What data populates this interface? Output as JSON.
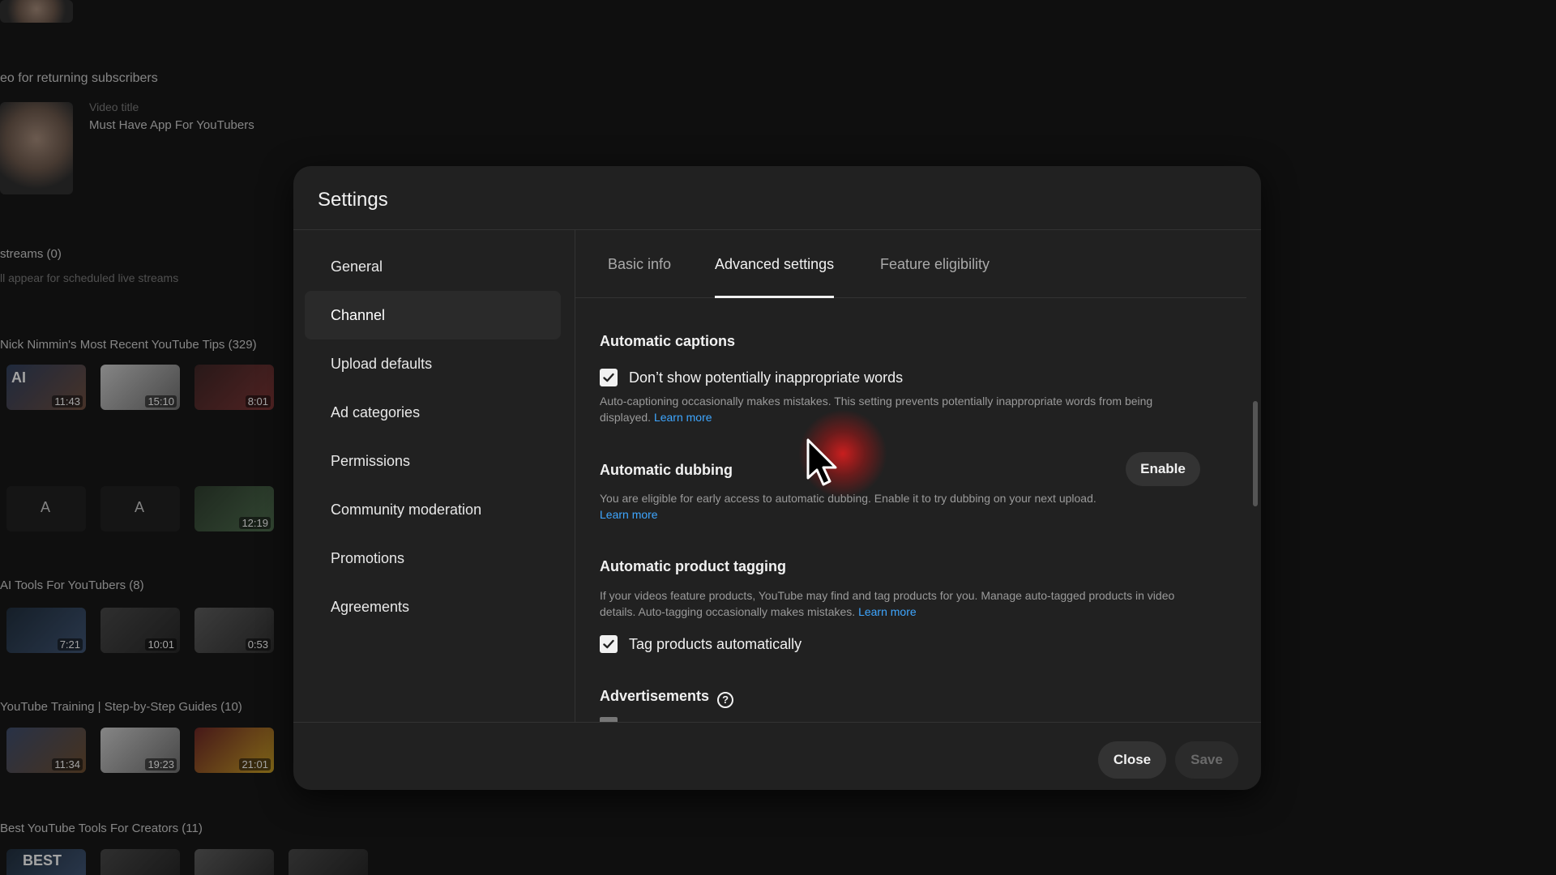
{
  "background": {
    "top_text": "eo for returning subscribers",
    "video_title_label": "Video title",
    "video_title": "Must Have App For YouTubers",
    "streams_heading": "streams (0)",
    "streams_sub": "ll appear for scheduled live streams",
    "playlists": [
      {
        "title": "Nick Nimmin's Most Recent YouTube Tips (329)",
        "durations": [
          "11:43",
          "15:10",
          "8:01"
        ],
        "first_label": "AI"
      },
      {
        "title": "",
        "durations": [
          "",
          "",
          "12:19"
        ],
        "first_label": "A",
        "second_label": "A"
      },
      {
        "title": "AI Tools For YouTubers (8)",
        "durations": [
          "7:21",
          "10:01",
          "0:53"
        ]
      },
      {
        "title": "YouTube Training | Step-by-Step Guides (10)",
        "durations": [
          "11:34",
          "19:23",
          "21:01"
        ]
      },
      {
        "title": "Best YouTube Tools For Creators (11)",
        "durations": [],
        "first_label": "BEST"
      }
    ]
  },
  "modal": {
    "title": "Settings",
    "sidebar": [
      {
        "label": "General"
      },
      {
        "label": "Channel",
        "active": true
      },
      {
        "label": "Upload defaults"
      },
      {
        "label": "Ad categories"
      },
      {
        "label": "Permissions"
      },
      {
        "label": "Community moderation"
      },
      {
        "label": "Promotions"
      },
      {
        "label": "Agreements"
      }
    ],
    "tabs": [
      {
        "label": "Basic info"
      },
      {
        "label": "Advanced settings",
        "active": true
      },
      {
        "label": "Feature eligibility"
      }
    ],
    "sections": {
      "captions": {
        "title": "Automatic captions",
        "checkbox_label": "Don’t show potentially inappropriate words",
        "checked": true,
        "description": "Auto-captioning occasionally makes mistakes. This setting prevents potentially inappropriate words from being displayed.",
        "link": "Learn more"
      },
      "dubbing": {
        "title": "Automatic dubbing",
        "description": "You are eligible for early access to automatic dubbing. Enable it to try dubbing on your next upload.",
        "link": "Learn more",
        "button": "Enable"
      },
      "tagging": {
        "title": "Automatic product tagging",
        "description": "If your videos feature products, YouTube may find and tag products for you. Manage auto-tagged products in video details. Auto-tagging occasionally makes mistakes.",
        "link": "Learn more",
        "checkbox_label": "Tag products automatically",
        "checked": true
      },
      "ads": {
        "title": "Advertisements",
        "help_icon": "help-circle-icon"
      }
    },
    "footer": {
      "close": "Close",
      "save": "Save"
    }
  },
  "colors": {
    "modal_bg": "#212121",
    "page_bg": "#0f0f0f",
    "link": "#3ea6ff",
    "cursor_highlight": "#e01e1e"
  }
}
